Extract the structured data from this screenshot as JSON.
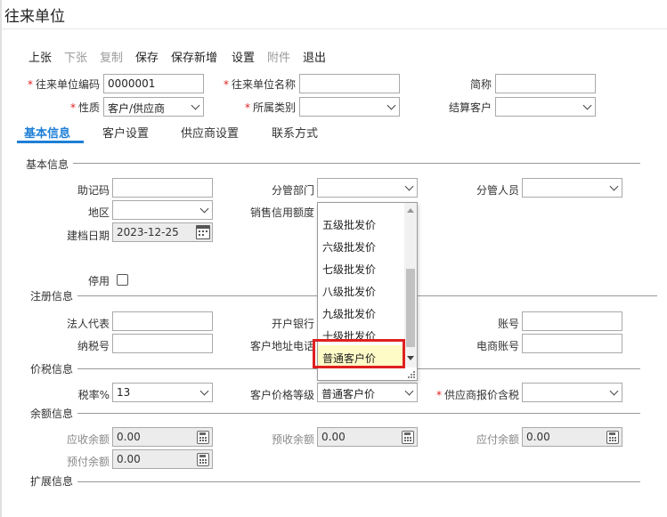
{
  "window": {
    "title": "往来单位"
  },
  "toolbar": {
    "new": "上张",
    "next": "下张",
    "copy": "复制",
    "save": "保存",
    "save_new": "保存新增",
    "settings": "设置",
    "attachment": "附件",
    "exit": "退出"
  },
  "header": {
    "code_label": "往来单位编码",
    "code_value": "0000001",
    "name_label": "往来单位名称",
    "name_value": "",
    "abbr_label": "简称",
    "abbr_value": "",
    "nature_label": "性质",
    "nature_value": "客户/供应商",
    "category_label": "所属类别",
    "category_value": "",
    "settle_label": "结算客户",
    "settle_value": ""
  },
  "tabs": {
    "basic": "基本信息",
    "customer": "客户设置",
    "supplier": "供应商设置",
    "contact": "联系方式"
  },
  "basic": {
    "section": "基本信息",
    "mnemonic_label": "助记码",
    "mnemonic_value": "",
    "dept_label": "分管部门",
    "dept_value": "",
    "person_label": "分管人员",
    "person_value": "",
    "region_label": "地区",
    "region_value": "",
    "credit_label": "销售信用额度",
    "date_label": "建档日期",
    "date_value": "2023-12-25",
    "disable_label": "停用"
  },
  "reg": {
    "section": "注册信息",
    "legal_label": "法人代表",
    "legal_value": "",
    "bank_label": "开户银行",
    "account_label": "账号",
    "account_value": "",
    "tax_no_label": "纳税号",
    "tax_no_value": "",
    "addr_label": "客户地址电话",
    "ecom_label": "电商账号",
    "ecom_value": ""
  },
  "price": {
    "section": "价税信息",
    "tax_rate_label": "税率%",
    "tax_rate_value": "13",
    "price_level_label": "客户价格等级",
    "price_level_value": "普通客户价",
    "supplier_tax_label": "供应商报价含税",
    "supplier_tax_value": ""
  },
  "balance": {
    "section": "余额信息",
    "receivable_label": "应收余额",
    "receivable_value": "0.00",
    "prereceipt_label": "预收余额",
    "prereceipt_value": "0.00",
    "payable_label": "应付余额",
    "payable_value": "0.00",
    "prepay_label": "预付余额",
    "prepay_value": "0.00"
  },
  "ext": {
    "section": "扩展信息"
  },
  "dropdown": {
    "items": [
      "五级批发价",
      "六级批发价",
      "七级批发价",
      "八级批发价",
      "九级批发价",
      "十级批发价",
      "普通客户价"
    ],
    "selected": "普通客户价"
  },
  "colors": {
    "accent": "#1e7fd6",
    "required": "#e02020",
    "highlight": "#fffbc6"
  }
}
